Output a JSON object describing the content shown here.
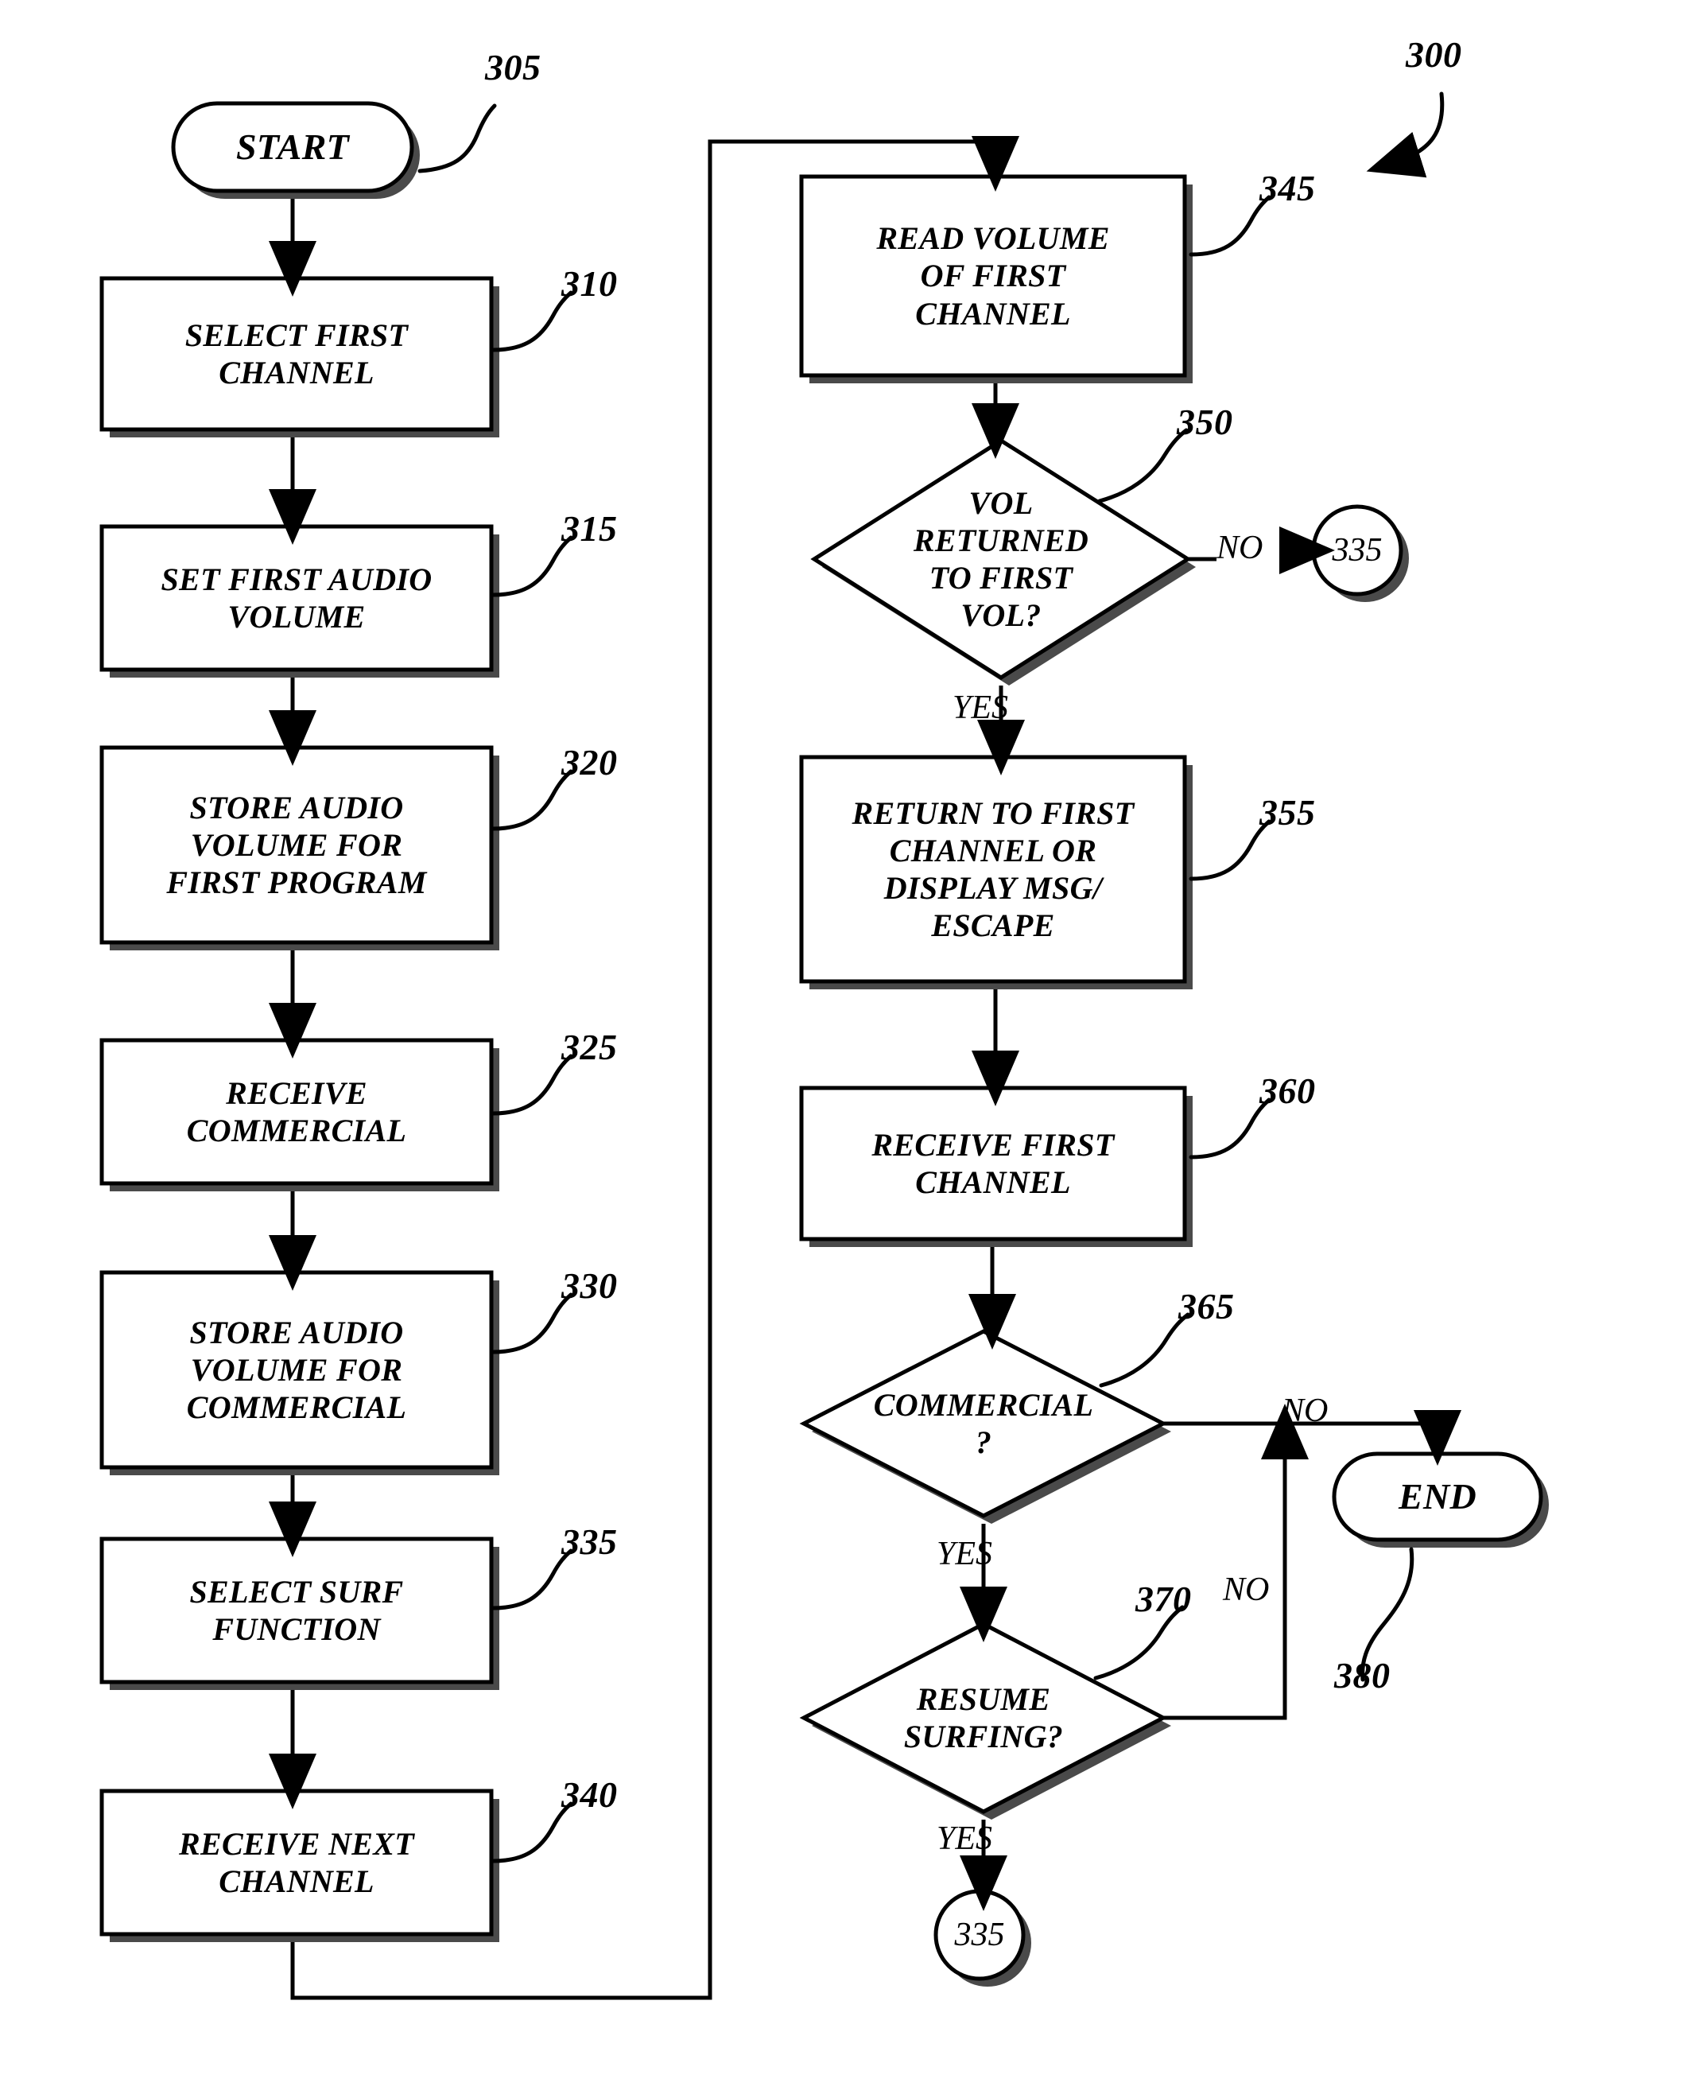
{
  "figure": {
    "ref": "300",
    "type": "flowchart"
  },
  "nodes": {
    "start": {
      "ref": "305",
      "shape": "terminator",
      "lines": [
        "START"
      ]
    },
    "n310": {
      "ref": "310",
      "shape": "process",
      "lines": [
        "SELECT FIRST",
        "CHANNEL"
      ]
    },
    "n315": {
      "ref": "315",
      "shape": "process",
      "lines": [
        "SET FIRST AUDIO",
        "VOLUME"
      ]
    },
    "n320": {
      "ref": "320",
      "shape": "process",
      "lines": [
        "STORE AUDIO",
        "VOLUME FOR",
        "FIRST PROGRAM"
      ]
    },
    "n325": {
      "ref": "325",
      "shape": "process",
      "lines": [
        "RECEIVE",
        "COMMERCIAL"
      ]
    },
    "n330": {
      "ref": "330",
      "shape": "process",
      "lines": [
        "STORE AUDIO",
        "VOLUME FOR",
        "COMMERCIAL"
      ]
    },
    "n335": {
      "ref": "335",
      "shape": "process",
      "lines": [
        "SELECT SURF",
        "FUNCTION"
      ]
    },
    "n340": {
      "ref": "340",
      "shape": "process",
      "lines": [
        "RECEIVE NEXT",
        "CHANNEL"
      ]
    },
    "n345": {
      "ref": "345",
      "shape": "process",
      "lines": [
        "READ VOLUME",
        "OF FIRST",
        "CHANNEL"
      ]
    },
    "n350": {
      "ref": "350",
      "shape": "decision",
      "lines": [
        "VOL",
        "RETURNED",
        "TO FIRST",
        "VOL?"
      ]
    },
    "n355": {
      "ref": "355",
      "shape": "process",
      "lines": [
        "RETURN TO FIRST",
        "CHANNEL OR",
        "DISPLAY MSG/",
        "ESCAPE"
      ]
    },
    "n360": {
      "ref": "360",
      "shape": "process",
      "lines": [
        "RECEIVE FIRST",
        "CHANNEL"
      ]
    },
    "n365": {
      "ref": "365",
      "shape": "decision",
      "lines": [
        "COMMERCIAL",
        "?"
      ]
    },
    "n370": {
      "ref": "370",
      "shape": "decision",
      "lines": [
        "RESUME",
        "SURFING?"
      ]
    },
    "end": {
      "ref": "380",
      "shape": "terminator",
      "lines": [
        "END"
      ]
    },
    "conn_a": {
      "shape": "connector",
      "label": "335"
    },
    "conn_b": {
      "shape": "connector",
      "label": "335"
    }
  },
  "edge_labels": {
    "vol_no": "NO",
    "vol_yes": "YES",
    "commercial_no": "NO",
    "commercial_yes": "YES",
    "resume_no": "NO",
    "resume_yes": "YES"
  },
  "colors": {
    "stroke": "#000000",
    "fill": "#ffffff",
    "shadow": "#555555",
    "background": "#ffffff"
  }
}
